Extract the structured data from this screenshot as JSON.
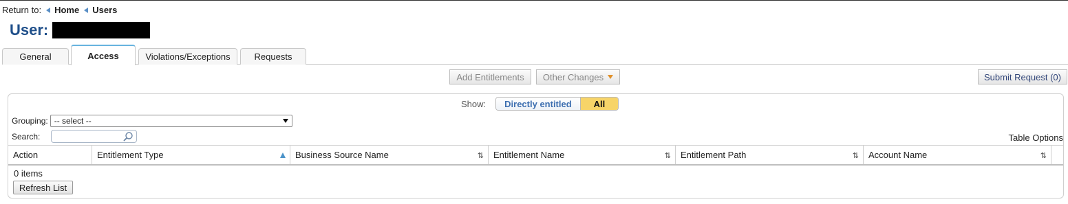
{
  "breadcrumb": {
    "prefix": "Return to:",
    "items": [
      "Home",
      "Users"
    ]
  },
  "page": {
    "title": "User:"
  },
  "tabs": [
    {
      "label": "General"
    },
    {
      "label": "Access",
      "active": true
    },
    {
      "label": "Violations/Exceptions"
    },
    {
      "label": "Requests"
    }
  ],
  "toolbar": {
    "add_entitlements": "Add Entitlements",
    "other_changes": "Other Changes",
    "submit_request": "Submit Request (0)"
  },
  "filters": {
    "show_label": "Show:",
    "show_options": [
      "Directly entitled",
      "All"
    ],
    "show_selected": "All",
    "grouping_label": "Grouping:",
    "grouping_value": "-- select --",
    "search_label": "Search:",
    "search_value": "",
    "table_options": "Table Options"
  },
  "table": {
    "columns": [
      "Action",
      "Entitlement Type",
      "Business Source Name",
      "Entitlement Name",
      "Entitlement Path",
      "Account Name"
    ],
    "sorted_column": "Entitlement Type",
    "rows": [],
    "item_count": "0 items",
    "refresh_label": "Refresh List"
  },
  "colors": {
    "title": "#1f4f8a",
    "active_tab_border": "#67b3df",
    "selected_filter": "#f7d468",
    "link_blue": "#3d6fb0",
    "caret": "#e0902a"
  },
  "icons": [
    "back-triangle-icon",
    "search-icon",
    "dropdown-arrow-icon",
    "sort-asc-icon",
    "sort-both-icon"
  ]
}
